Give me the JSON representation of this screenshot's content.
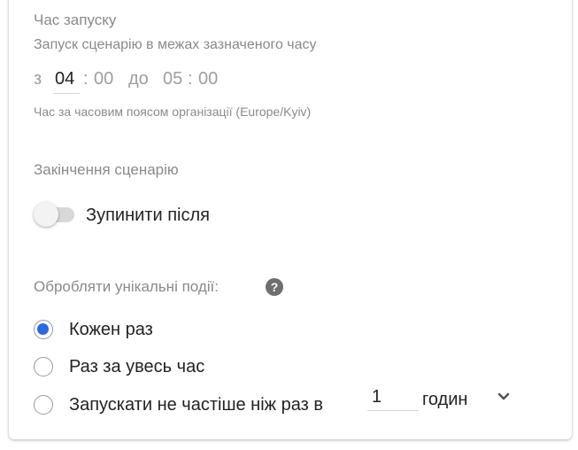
{
  "start_time": {
    "title": "Час запуску",
    "subtitle": "Запуск сценарію в межах зазначеного часу",
    "from_label": "з",
    "from_hours": "04",
    "from_sep": ":",
    "from_minutes": "00",
    "to_label": "до",
    "to_hours": "05",
    "to_sep": ":",
    "to_minutes": "00",
    "timezone_hint": "Час за часовим поясом організації (Europe/Kyiv)"
  },
  "end_scenario": {
    "title": "Закінчення сценарію",
    "toggle_label": "Зупинити після",
    "toggle_on": false
  },
  "unique_events": {
    "title": "Обробляти унікальні події:",
    "help_icon": "question-circle-icon",
    "options": [
      {
        "label": "Кожен раз",
        "checked": true
      },
      {
        "label": "Раз за увесь час",
        "checked": false
      },
      {
        "label": "Запускати не частіше ніж раз в",
        "checked": false
      }
    ],
    "interval_value": "1",
    "interval_unit": "годин",
    "unit_icon": "chevron-down-icon"
  },
  "colors": {
    "accent": "#2a6ae0",
    "muted_text": "#8a8a8a",
    "main_text": "#222222"
  }
}
